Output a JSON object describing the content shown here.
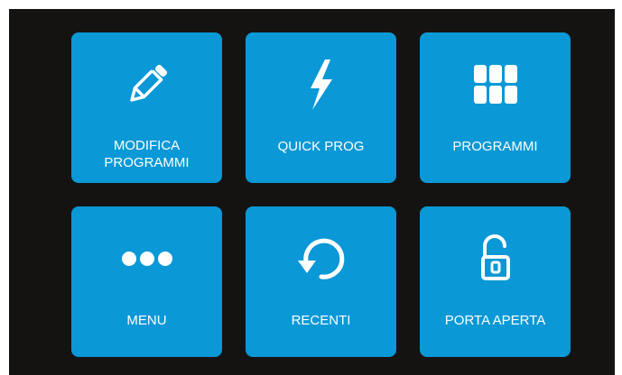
{
  "tiles": [
    {
      "label": "MODIFICA\nPROGRAMMI",
      "icon": "pencil-icon"
    },
    {
      "label": "QUICK PROG",
      "icon": "lightning-bolt-icon"
    },
    {
      "label": "PROGRAMMI",
      "icon": "grid-icon"
    },
    {
      "label": "MENU",
      "icon": "more-dots-icon"
    },
    {
      "label": "RECENTI",
      "icon": "history-icon"
    },
    {
      "label": "PORTA APERTA",
      "icon": "unlock-icon"
    }
  ],
  "colors": {
    "background": "#151312",
    "tile": "#0a98d6",
    "text": "#ffffff"
  }
}
